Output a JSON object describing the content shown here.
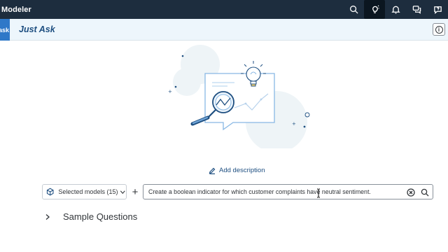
{
  "shell": {
    "title": "Modeler",
    "actions": [
      "search-icon",
      "lightbulb-icon",
      "bell-icon",
      "chat-icon",
      "help-icon"
    ],
    "active_action": "lightbulb-icon"
  },
  "subheader": {
    "left_tab_label": "ask",
    "title": "Just Ask",
    "info_label": "i"
  },
  "illustration": {
    "name": "magnifier-chart-lightbulb-illustration"
  },
  "add_description": {
    "label": "Add description"
  },
  "query_bar": {
    "model_selector_label": "Selected models (15)",
    "add_label": "+",
    "query_value": "Create a boolean indicator for which customer complaints have neutral sentiment."
  },
  "sample_questions": {
    "label": "Sample Questions"
  },
  "colors": {
    "shell_bg": "#1d2d3e",
    "subheader_bg": "#edf6fc",
    "accent_blue": "#2f78c8",
    "link_blue": "#1d4e80"
  }
}
